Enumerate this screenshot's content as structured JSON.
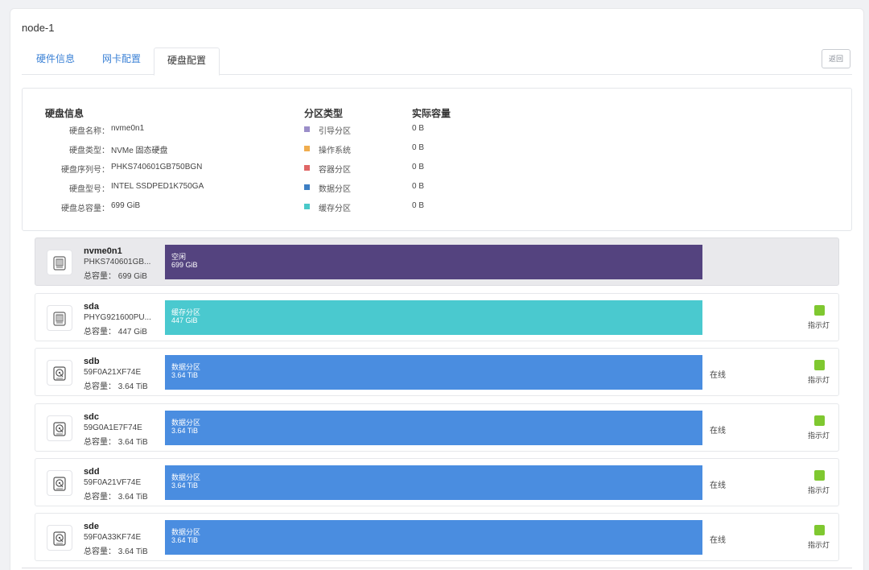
{
  "node": {
    "title": "node-1"
  },
  "tabs": [
    {
      "label": "硬件信息"
    },
    {
      "label": "网卡配置"
    },
    {
      "label": "硬盘配置"
    }
  ],
  "back_label": "返回",
  "info": {
    "headers": {
      "disk_info": "硬盘信息",
      "partition_type": "分区类型",
      "actual_capacity": "实际容量"
    },
    "fields": [
      {
        "label": "硬盘名称：",
        "value": "nvme0n1"
      },
      {
        "label": "硬盘类型：",
        "value": "NVMe 固态硬盘"
      },
      {
        "label": "硬盘序列号：",
        "value": "PHKS740601GB750BGN"
      },
      {
        "label": "硬盘型号：",
        "value": "INTEL SSDPED1K750GA"
      },
      {
        "label": "硬盘总容量：",
        "value": "699 GiB"
      }
    ],
    "partitions": [
      {
        "name": "引导分区",
        "color": "#9b8ec9",
        "capacity": "0 B"
      },
      {
        "name": "操作系统",
        "color": "#f0ad4e",
        "capacity": "0 B"
      },
      {
        "name": "容器分区",
        "color": "#e06666",
        "capacity": "0 B"
      },
      {
        "name": "数据分区",
        "color": "#3d7fc4",
        "capacity": "0 B"
      },
      {
        "name": "缓存分区",
        "color": "#4ac9c9",
        "capacity": "0 B"
      }
    ]
  },
  "indicator_label": "指示灯",
  "disks": [
    {
      "name": "nvme0n1",
      "serial": "PHKS740601GB...",
      "size": "总容量：  699 GiB",
      "bar_label": "空闲",
      "bar_cap": "699 GiB",
      "bar_color": "#54437f",
      "status": "",
      "icon": "ssd-icon"
    },
    {
      "name": "sda",
      "serial": "PHYG921600PU...",
      "size": "总容量：  447 GiB",
      "bar_label": "缓存分区",
      "bar_cap": "447 GiB",
      "bar_color": "#4ac9cf",
      "status": "",
      "icon": "ssd-icon"
    },
    {
      "name": "sdb",
      "serial": "59F0A21XF74E",
      "size": "总容量：  3.64 TiB",
      "bar_label": "数据分区",
      "bar_cap": "3.64 TiB",
      "bar_color": "#4a8de0",
      "status": "在线",
      "icon": "hdd-icon"
    },
    {
      "name": "sdc",
      "serial": "59G0A1E7F74E",
      "size": "总容量：  3.64 TiB",
      "bar_label": "数据分区",
      "bar_cap": "3.64 TiB",
      "bar_color": "#4a8de0",
      "status": "在线",
      "icon": "hdd-icon"
    },
    {
      "name": "sdd",
      "serial": "59F0A21VF74E",
      "size": "总容量：  3.64 TiB",
      "bar_label": "数据分区",
      "bar_cap": "3.64 TiB",
      "bar_color": "#4a8de0",
      "status": "在线",
      "icon": "hdd-icon"
    },
    {
      "name": "sde",
      "serial": "59F0A33KF74E",
      "size": "总容量：  3.64 TiB",
      "bar_label": "数据分区",
      "bar_cap": "3.64 TiB",
      "bar_color": "#4a8de0",
      "status": "在线",
      "icon": "hdd-icon"
    }
  ],
  "colors": {
    "indicator_on": "#7fc830",
    "tab_link": "#3c82d6"
  }
}
